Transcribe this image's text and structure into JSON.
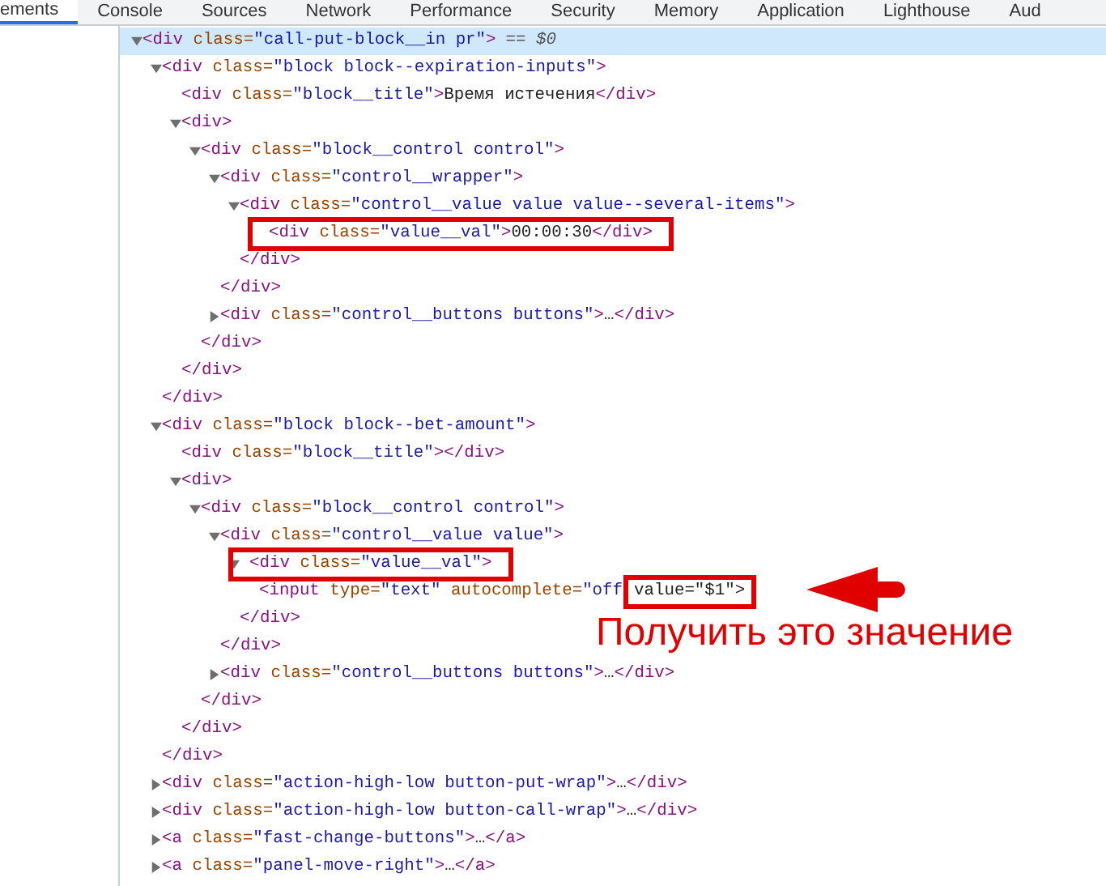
{
  "tabs": [
    {
      "label": "ements",
      "selected": true
    },
    {
      "label": "Console",
      "selected": false
    },
    {
      "label": "Sources",
      "selected": false
    },
    {
      "label": "Network",
      "selected": false
    },
    {
      "label": "Performance",
      "selected": false
    },
    {
      "label": "Security",
      "selected": false
    },
    {
      "label": "Memory",
      "selected": false
    },
    {
      "label": "Application",
      "selected": false
    },
    {
      "label": "Lighthouse",
      "selected": false
    },
    {
      "label": "Aud",
      "selected": false
    }
  ],
  "tree": [
    {
      "line": "<div class=\"call-put-block__in pr\">",
      "console_ref": "== $0",
      "expanded": true,
      "selected": true,
      "boxed": false,
      "children": [
        {
          "line": "<div class=\"block block--expiration-inputs\">",
          "expanded": true,
          "selected": false,
          "boxed": false,
          "close": "</div>",
          "children": [
            {
              "line": "<div class=\"block__title\">Время истечения</div>",
              "selected": false,
              "boxed": false
            },
            {
              "line": "<div>",
              "expanded": true,
              "selected": false,
              "boxed": false,
              "close": "</div>",
              "children": [
                {
                  "line": "<div class=\"block__control control\">",
                  "expanded": true,
                  "selected": false,
                  "boxed": false,
                  "close": "</div>",
                  "children": [
                    {
                      "line": "<div class=\"control__wrapper\">",
                      "expanded": true,
                      "selected": false,
                      "boxed": false,
                      "close": "</div>",
                      "children": [
                        {
                          "line": "<div class=\"control__value value value--several-items\">",
                          "expanded": true,
                          "selected": false,
                          "boxed": false,
                          "close": "</div>",
                          "children": [
                            {
                              "line": "<div class=\"value__val\">00:00:30</div>",
                              "selected": false,
                              "boxed": true
                            }
                          ]
                        }
                      ]
                    },
                    {
                      "line": "<div class=\"control__buttons buttons\">…</div>",
                      "expanded": false,
                      "selected": false,
                      "boxed": false
                    }
                  ]
                }
              ]
            }
          ]
        },
        {
          "line": "<div class=\"block block--bet-amount\">",
          "expanded": true,
          "selected": false,
          "boxed": false,
          "close": "</div>",
          "children": [
            {
              "line": "<div class=\"block__title\"></div>",
              "selected": false,
              "boxed": false
            },
            {
              "line": "<div>",
              "expanded": true,
              "selected": false,
              "boxed": false,
              "close": "</div>",
              "children": [
                {
                  "line": "<div class=\"block__control control\">",
                  "expanded": true,
                  "selected": false,
                  "boxed": false,
                  "close": "</div>",
                  "children": [
                    {
                      "line": "<div class=\"control__value value\">",
                      "expanded": true,
                      "selected": false,
                      "boxed": false,
                      "close": "</div>",
                      "children": [
                        {
                          "line": "<div class=\"value__val\">",
                          "expanded": true,
                          "selected": false,
                          "boxed": true,
                          "close": "</div>",
                          "children": [
                            {
                              "line": "<input type=\"text\" autocomplete=\"off",
                              "boxed_part": " value=\"$1\">",
                              "selected": false,
                              "boxed": false
                            }
                          ]
                        }
                      ]
                    },
                    {
                      "line": "<div class=\"control__buttons buttons\">…</div>",
                      "expanded": false,
                      "selected": false,
                      "boxed": false
                    }
                  ]
                }
              ]
            }
          ]
        },
        {
          "line": "<div class=\"action-high-low button-put-wrap\">…</div>",
          "expanded": false,
          "selected": false,
          "boxed": false
        },
        {
          "line": "<div class=\"action-high-low button-call-wrap\">…</div>",
          "expanded": false,
          "selected": false,
          "boxed": false
        },
        {
          "line": "<a class=\"fast-change-buttons\">…</a>",
          "expanded": false,
          "selected": false,
          "boxed": false
        },
        {
          "line": "<a class=\"panel-move-right\">…</a>",
          "expanded": false,
          "selected": false,
          "boxed": false
        }
      ]
    }
  ],
  "annotation": {
    "text": "Получить это значение"
  }
}
